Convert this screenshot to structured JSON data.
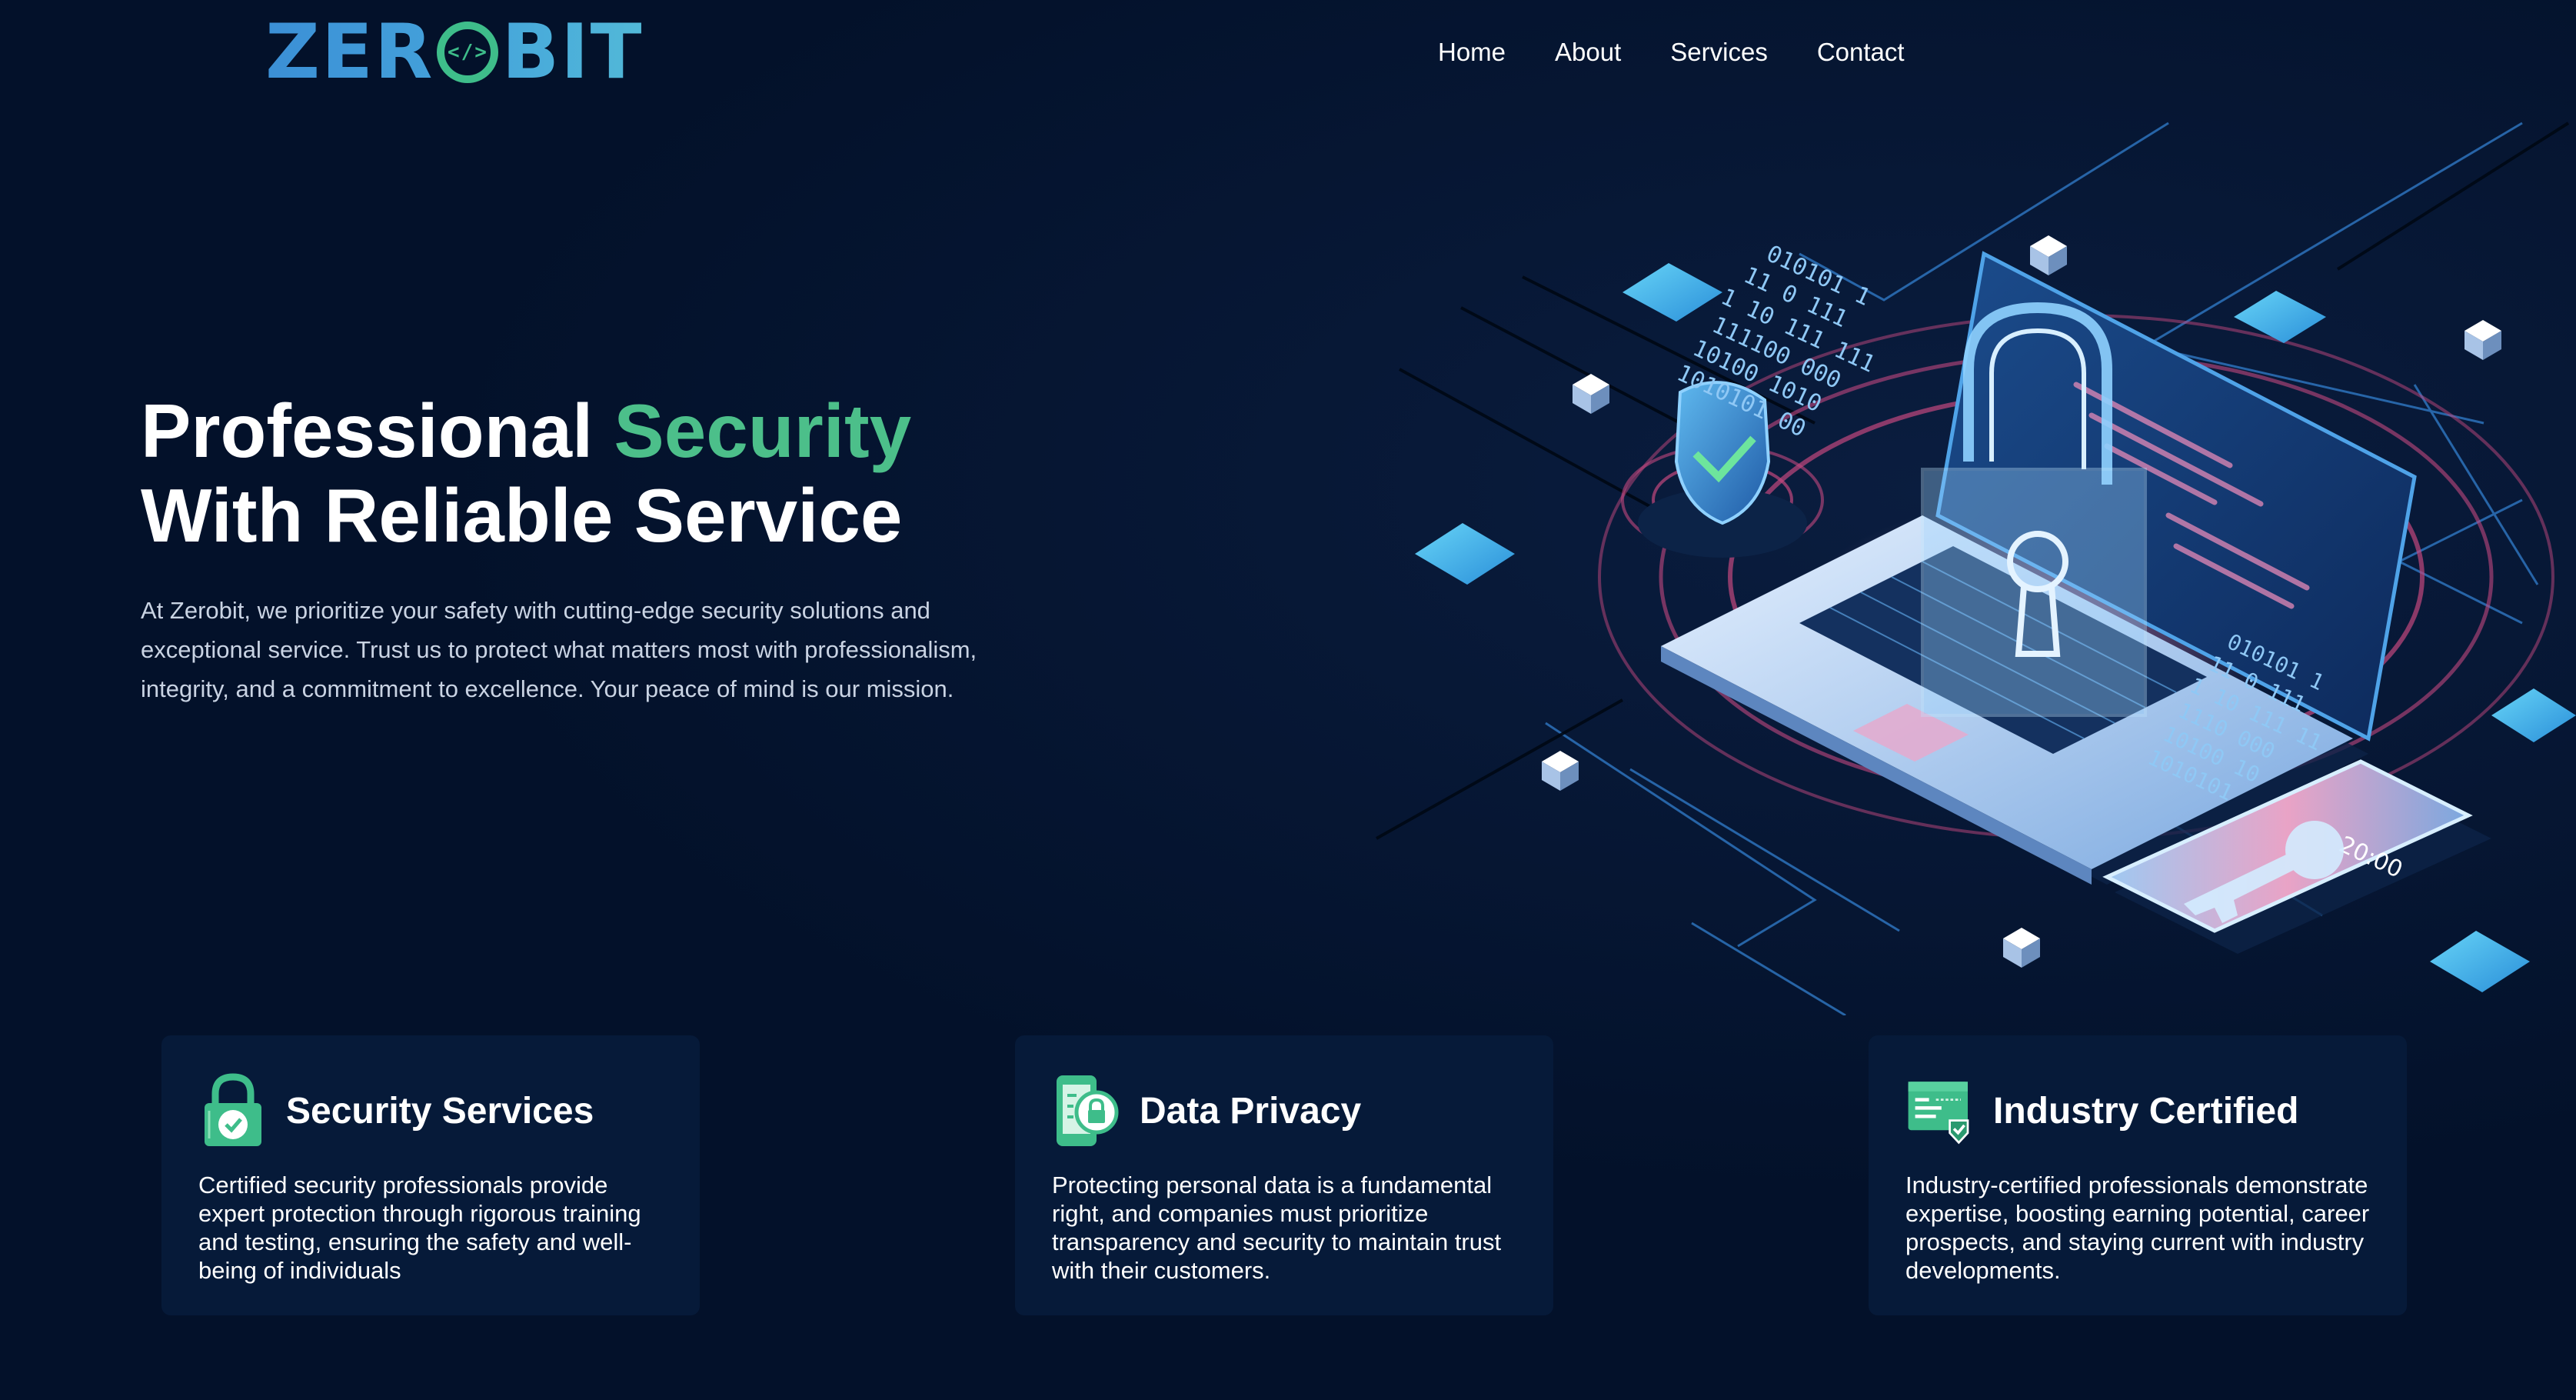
{
  "brand": {
    "logo_left": "ZER",
    "logo_right": "BIT"
  },
  "nav": {
    "items": [
      "Home",
      "About",
      "Services",
      "Contact"
    ]
  },
  "hero": {
    "title_part1": "Professional ",
    "title_accent": "Security",
    "title_line2": "With Reliable Service",
    "description": "At Zerobit, we prioritize your safety with cutting-edge security solutions and exceptional service. Trust us to protect what matters most with professionalism, integrity, and a commitment to excellence. Your peace of mind is our mission."
  },
  "illustration": {
    "binary_top": [
      "010101 1",
      "11 0   111",
      "1 10  111  111",
      "111100 000",
      "10100 1010",
      "1010101 00"
    ],
    "binary_right": [
      "010101 1",
      "11 0  111",
      "1 10  111 11",
      "1110 000",
      "10100 10",
      "1010101"
    ],
    "phone_time": "20:00"
  },
  "features": [
    {
      "icon": "padlock-check-icon",
      "title": "Security Services",
      "text": "Certified security professionals provide expert protection through rigorous training and testing, ensuring the safety and well-being of individuals"
    },
    {
      "icon": "phone-lock-icon",
      "title": "Data Privacy",
      "text": "Protecting personal data is a fundamental right, and companies must prioritize transparency and security to maintain trust with their customers."
    },
    {
      "icon": "certificate-icon",
      "title": "Industry Certified",
      "text": "Industry-certified professionals demonstrate expertise, boosting earning potential, career prospects, and staying current with industry developments."
    }
  ],
  "colors": {
    "background": "#03112a",
    "card": "#061a39",
    "accent_green": "#4cbf8a",
    "logo_blue": "#3b8fd6"
  }
}
